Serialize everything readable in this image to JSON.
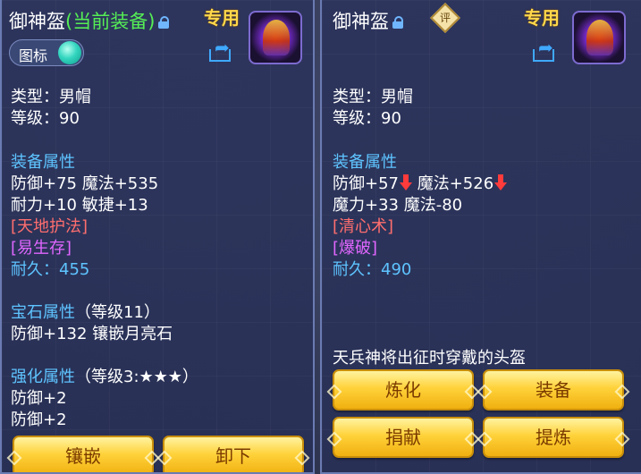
{
  "left_panel": {
    "title": "御神盔",
    "title_suffix": "(当前装备)",
    "special_tag": "专用",
    "toggle_label": "图标",
    "type_line": "类型：男帽",
    "level_line": "等级：90",
    "attr_header": "装备属性",
    "attr_line1": "防御+75 魔法+535",
    "attr_line2": "耐力+10 敏捷+13",
    "skill1": "[天地护法]",
    "skill2": "[易生存]",
    "durability": "耐久：455",
    "gem_header": "宝石属性",
    "gem_level": "（等级11）",
    "gem_line": "防御+132 镶嵌月亮石",
    "enhance_header": "强化属性",
    "enhance_level": "（等级3:★★★）",
    "enhance_line1": "防御+2",
    "enhance_line2": "防御+2",
    "btn_inlay": "镶嵌",
    "btn_unequip": "卸下"
  },
  "right_panel": {
    "title": "御神盔",
    "badge": "评",
    "special_tag": "专用",
    "type_line": "类型：男帽",
    "level_line": "等级：90",
    "attr_header": "装备属性",
    "attr_a": "防御+57",
    "attr_b": " 魔法+526",
    "attr_line2": "魔力+33 魔法-80",
    "skill1": "[清心术]",
    "skill2": "[爆破]",
    "durability": "耐久：490",
    "description": "天兵神将出征时穿戴的头盔",
    "btn_refine": "炼化",
    "btn_equip": "装备",
    "btn_donate": "捐献",
    "btn_extract": "提炼"
  },
  "colors": {
    "equipped_green": "#55ee55",
    "section_blue": "#5ec4ff",
    "skill_red": "#ff6e6e",
    "skill_purple": "#e066ff",
    "gold_button": "#ffd23a",
    "tag_yellow": "#ffd84a"
  },
  "icons": [
    "lock-icon",
    "share-icon",
    "helmet-icon",
    "rating-badge-icon",
    "arrow-down-icon"
  ]
}
